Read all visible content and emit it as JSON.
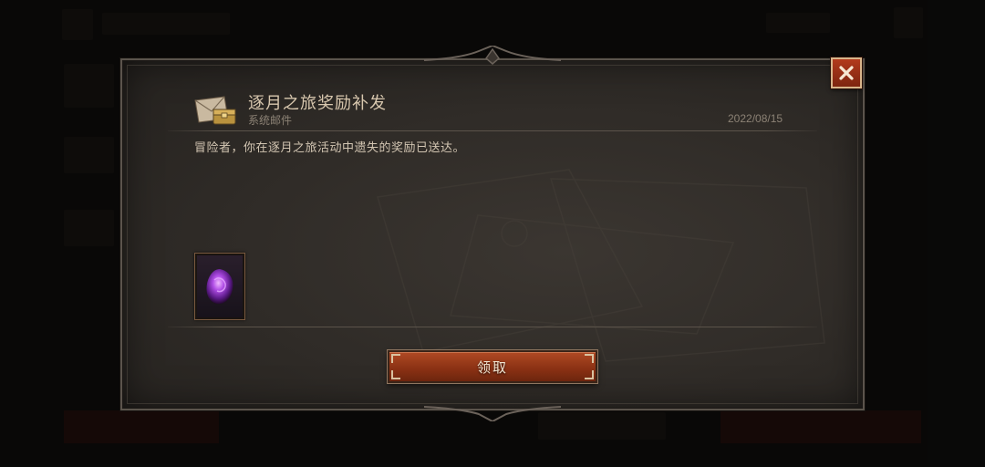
{
  "mail": {
    "title": "逐月之旅奖励补发",
    "sender": "系统邮件",
    "date": "2022/08/15",
    "body": "冒险者，你在逐月之旅活动中遗失的奖励已送达。"
  },
  "rewards": [
    {
      "icon": "purple-gem-icon",
      "color": "#9b3fd6"
    }
  ],
  "actions": {
    "claim_label": "领取",
    "close_icon": "close-icon"
  },
  "colors": {
    "accent": "#a2401c",
    "frame": "#d8b48a",
    "title_text": "#d8c7ae"
  }
}
